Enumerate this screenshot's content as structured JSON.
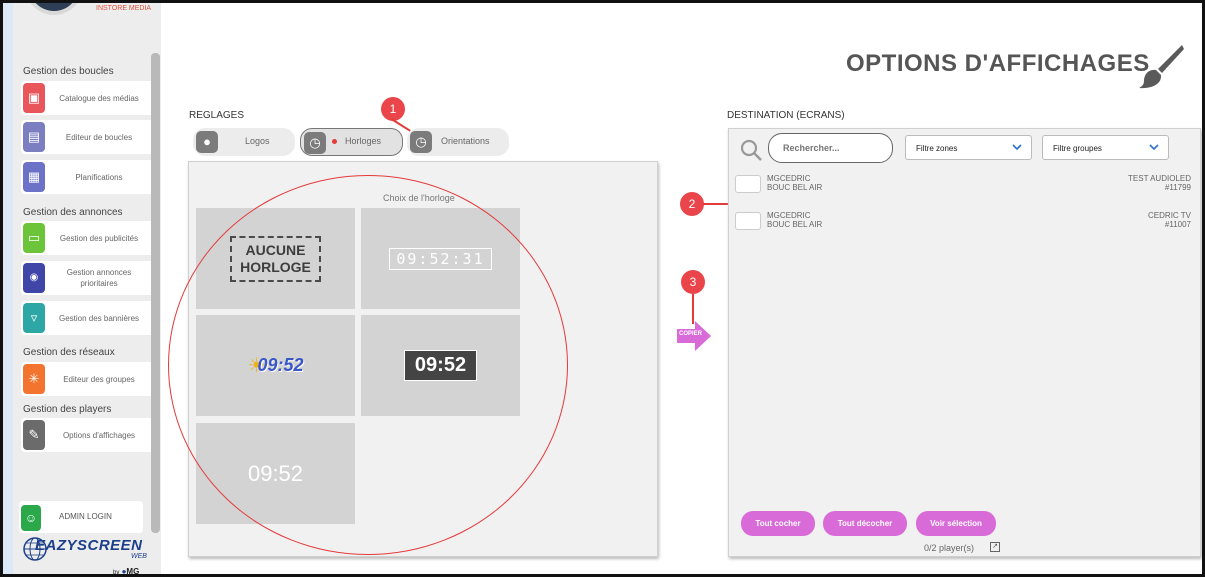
{
  "sidebar": {
    "brand_caption": "INSTORE MEDIA",
    "sections": {
      "boucles": "Gestion des boucles",
      "annonces": "Gestion des annonces",
      "reseaux": "Gestion des réseaux",
      "players": "Gestion des players"
    },
    "items": [
      {
        "label": "Catalogue des médias",
        "icon": "media-catalog-icon",
        "color": "#e8565b"
      },
      {
        "label": "Editeur de boucles",
        "icon": "loop-editor-icon",
        "color": "#7b7fc2"
      },
      {
        "label": "Planifications",
        "icon": "calendar-icon",
        "color": "#6b72c7"
      },
      {
        "label": "Gestion des publicités",
        "icon": "ads-icon",
        "color": "#6bc43a"
      },
      {
        "label": "Gestion annonces prioritaires",
        "icon": "broadcast-icon",
        "color": "#3f46a8"
      },
      {
        "label": "Gestion des bannières",
        "icon": "banner-icon",
        "color": "#2ca7a5"
      },
      {
        "label": "Editeur des groupes",
        "icon": "groups-icon",
        "color": "#f2742e"
      },
      {
        "label": "Options d'affichages",
        "icon": "brush-icon",
        "color": "#6b6b6b"
      }
    ],
    "admin_label": "ADMIN LOGIN",
    "brand_name": "EAZYSCREEN",
    "brand_sub": "WEB",
    "brand_by": "MG"
  },
  "page": {
    "title": "OPTIONS D'AFFICHAGES"
  },
  "settings": {
    "section_label": "REGLAGES",
    "tabs": [
      {
        "label": "Logos",
        "icon": "apple-icon"
      },
      {
        "label": "Horloges",
        "icon": "clock-icon",
        "active": true
      },
      {
        "label": "Orientations",
        "icon": "clock-icon"
      }
    ],
    "clock_choice_label": "Choix de l'horloge",
    "clock_options": {
      "none_line1": "AUCUNE",
      "none_line2": "HORLOGE",
      "digital": "09:52:31",
      "weather": "09:52",
      "dark": "09:52",
      "thin": "09:52"
    }
  },
  "copy_button": "COPIER",
  "markers": [
    "1",
    "2",
    "3"
  ],
  "destination": {
    "section_label": "DESTINATION (ECRANS)",
    "search_placeholder": "Rechercher...",
    "filter_zones": "Filtre zones",
    "filter_groups": "Filtre groupes",
    "screens": [
      {
        "line1": "MGCEDRIC",
        "line2": "BOUC BEL AIR",
        "name": "TEST AUDIOLED",
        "id": "#11799"
      },
      {
        "line1": "MGCEDRIC",
        "line2": "BOUC BEL AIR",
        "name": "CEDRIC TV",
        "id": "#11007"
      }
    ],
    "btn_check_all": "Tout cocher",
    "btn_uncheck_all": "Tout décocher",
    "btn_view_selection": "Voir sélection",
    "player_count": "0/2 player(s)"
  },
  "colors": {
    "accent_pink": "#d96bd8",
    "annotation_red": "#e53a3a"
  }
}
